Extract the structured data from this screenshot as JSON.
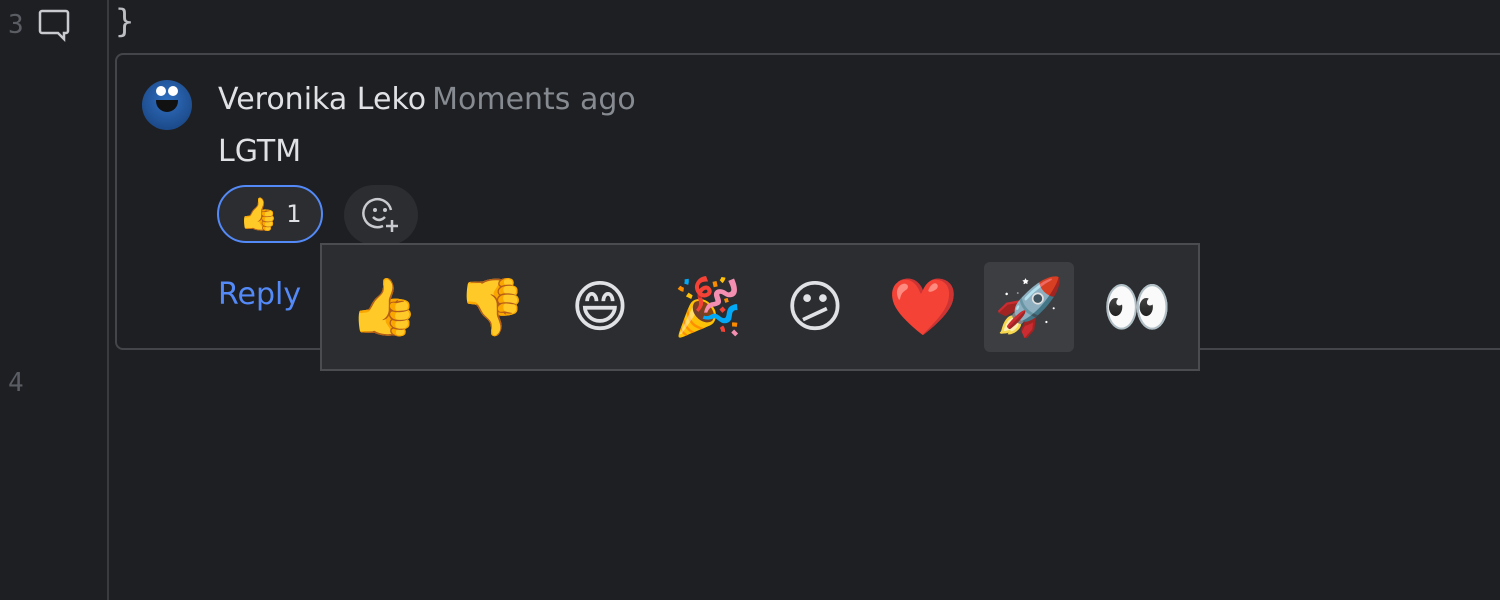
{
  "editor": {
    "line_numbers": [
      "3",
      "4"
    ],
    "code_line": "}"
  },
  "comment": {
    "author": "Veronika Leko",
    "timestamp": "Moments ago",
    "body": "LGTM",
    "reactions": [
      {
        "emoji": "👍",
        "count": "1",
        "selected": true
      }
    ],
    "reply_label": "Reply"
  },
  "emoji_picker": {
    "items": [
      "👍",
      "👎",
      "😄",
      "🎉",
      "😕",
      "❤️",
      "🚀",
      "👀"
    ],
    "hovered": "🚀"
  },
  "colors": {
    "accent": "#548af7",
    "background": "#1e1f22",
    "popup": "#2b2d30"
  }
}
